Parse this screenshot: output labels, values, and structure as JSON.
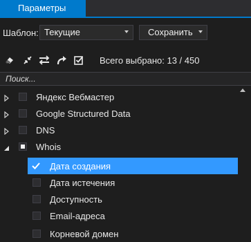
{
  "tab": {
    "label": "Параметры"
  },
  "template": {
    "label": "Шаблон:",
    "selected": "Текущие",
    "save_label": "Сохранить"
  },
  "toolbar": {
    "icons": [
      "eraser-icon",
      "collapse-icon",
      "swap-icon",
      "redo-arrow-icon",
      "check-all-icon"
    ],
    "selection_count": "Всего выбрано: 13 / 450"
  },
  "search": {
    "placeholder": "Поиск..."
  },
  "tree": {
    "items": [
      {
        "label": "Яндекс Вебмастер",
        "expanded": false,
        "checked": false
      },
      {
        "label": "Google Structured Data",
        "expanded": false,
        "checked": false
      },
      {
        "label": "DNS",
        "expanded": false,
        "checked": false
      },
      {
        "label": "Whois",
        "expanded": true,
        "checked": "partial",
        "children": [
          {
            "label": "Дата создания",
            "checked": true,
            "selected": true
          },
          {
            "label": "Дата истечения",
            "checked": false
          },
          {
            "label": "Доступность",
            "checked": false
          },
          {
            "label": "Email-адреса",
            "checked": false
          },
          {
            "label": "Корневой домен",
            "checked": false
          }
        ]
      }
    ]
  },
  "colors": {
    "accent": "#007acc",
    "selection": "#3399ff",
    "background": "#1e1e1e"
  }
}
